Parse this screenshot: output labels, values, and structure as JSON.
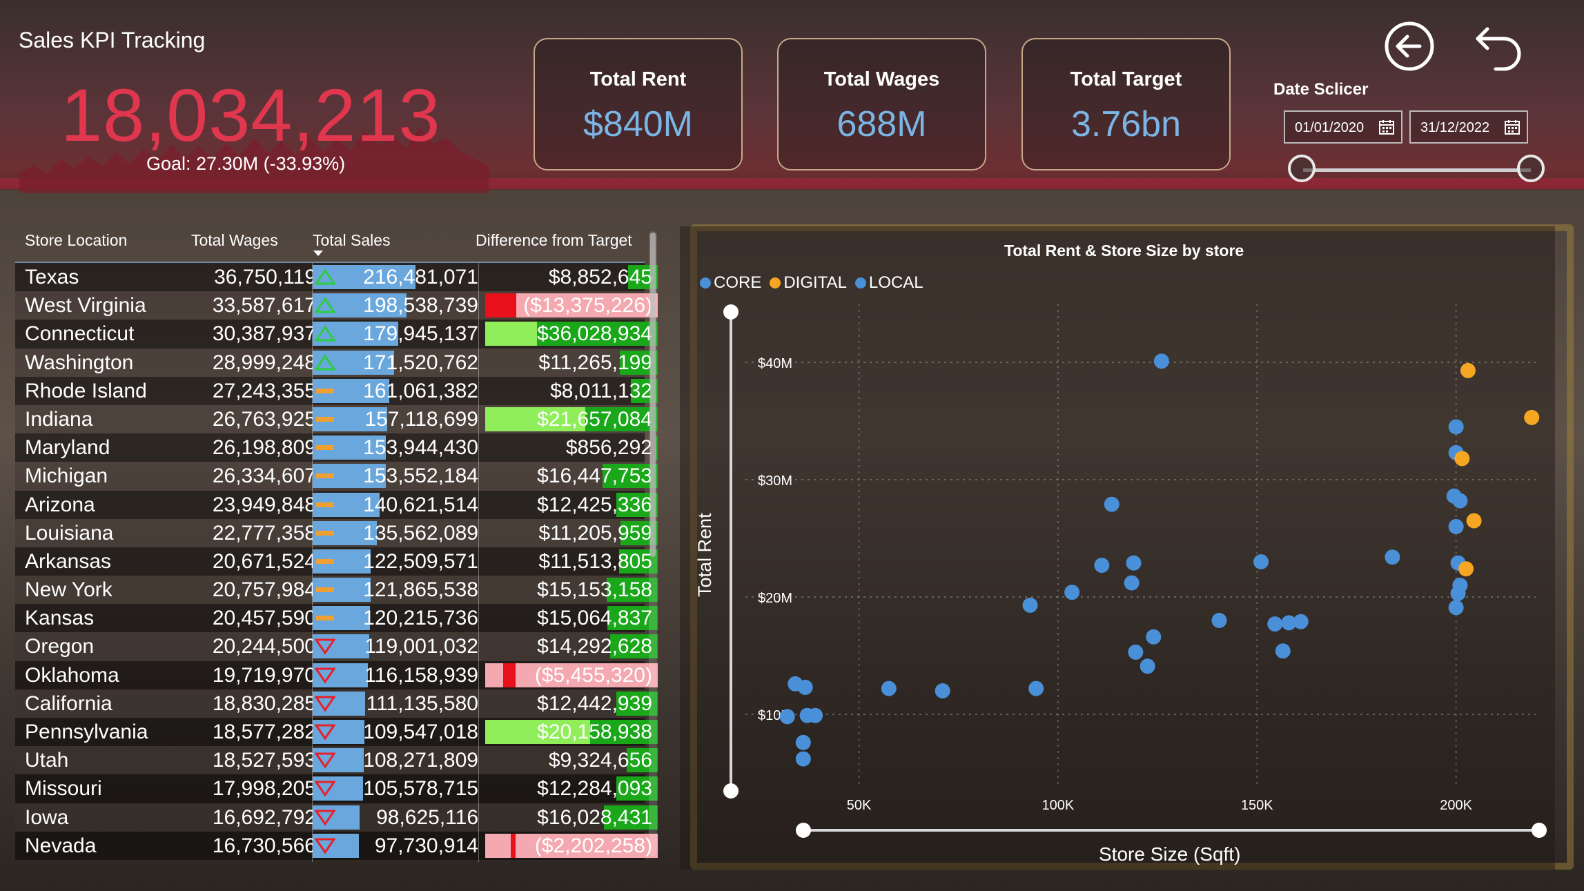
{
  "header": {
    "title": "Sales KPI Tracking",
    "kpi_value": "18,034,213",
    "goal_text": "Goal: 27.30M (-33.93%)"
  },
  "cards": [
    {
      "title": "Total Rent",
      "value": "$840M"
    },
    {
      "title": "Total Wages",
      "value": "688M"
    },
    {
      "title": "Total Target",
      "value": "3.76bn"
    }
  ],
  "nav": {
    "back_icon": "circle-arrow-left-icon",
    "undo_icon": "undo-arrow-icon"
  },
  "slicer": {
    "title": "Date Sclicer",
    "start_date": "01/01/2020",
    "end_date": "31/12/2022",
    "calendar_icon": "calendar-icon"
  },
  "table": {
    "columns": [
      "Store Location",
      "Total Wages",
      "Total Sales",
      "Difference from Target"
    ],
    "sorted_column": "Total Sales",
    "colors": {
      "up": "#2ecc40",
      "flat": "#f0a030",
      "down": "#e8202a",
      "sales_bar": "#6aa7dc",
      "pos_dark": "#1aa81a",
      "pos_light": "#90ee5a",
      "neg_red": "#e8101a",
      "neg_light": "#f4a8b0"
    },
    "rows": [
      {
        "location": "Texas",
        "wages": "36,750,119",
        "sales": "216,481,071",
        "sales_num": 216481071,
        "trend": "up",
        "diff": "$8,852,645",
        "diff_num": 8852645
      },
      {
        "location": "West Virginia",
        "wages": "33,587,617",
        "sales": "198,538,739",
        "sales_num": 198538739,
        "trend": "up",
        "diff": "($13,375,226)",
        "diff_num": -13375226
      },
      {
        "location": "Connecticut",
        "wages": "30,387,937",
        "sales": "179,945,137",
        "sales_num": 179945137,
        "trend": "up",
        "diff": "$36,028,934",
        "diff_num": 36028934
      },
      {
        "location": "Washington",
        "wages": "28,999,248",
        "sales": "171,520,762",
        "sales_num": 171520762,
        "trend": "up",
        "diff": "$11,265,199",
        "diff_num": 11265199
      },
      {
        "location": "Rhode Island",
        "wages": "27,243,355",
        "sales": "161,061,382",
        "sales_num": 161061382,
        "trend": "flat",
        "diff": "$8,011,132",
        "diff_num": 8011132
      },
      {
        "location": "Indiana",
        "wages": "26,763,925",
        "sales": "157,118,699",
        "sales_num": 157118699,
        "trend": "flat",
        "diff": "$21,657,084",
        "diff_num": 21657084
      },
      {
        "location": "Maryland",
        "wages": "26,198,809",
        "sales": "153,944,430",
        "sales_num": 153944430,
        "trend": "flat",
        "diff": "$856,292",
        "diff_num": 856292
      },
      {
        "location": "Michigan",
        "wages": "26,334,607",
        "sales": "153,552,184",
        "sales_num": 153552184,
        "trend": "flat",
        "diff": "$16,447,753",
        "diff_num": 16447753
      },
      {
        "location": "Arizona",
        "wages": "23,949,848",
        "sales": "140,621,514",
        "sales_num": 140621514,
        "trend": "flat",
        "diff": "$12,425,336",
        "diff_num": 12425336
      },
      {
        "location": "Louisiana",
        "wages": "22,777,358",
        "sales": "135,562,089",
        "sales_num": 135562089,
        "trend": "flat",
        "diff": "$11,205,959",
        "diff_num": 11205959
      },
      {
        "location": "Arkansas",
        "wages": "20,671,524",
        "sales": "122,509,571",
        "sales_num": 122509571,
        "trend": "flat",
        "diff": "$11,513,805",
        "diff_num": 11513805
      },
      {
        "location": "New York",
        "wages": "20,757,984",
        "sales": "121,865,538",
        "sales_num": 121865538,
        "trend": "flat",
        "diff": "$15,153,158",
        "diff_num": 15153158
      },
      {
        "location": "Kansas",
        "wages": "20,457,590",
        "sales": "120,215,736",
        "sales_num": 120215736,
        "trend": "flat",
        "diff": "$15,064,837",
        "diff_num": 15064837
      },
      {
        "location": "Oregon",
        "wages": "20,244,500",
        "sales": "119,001,032",
        "sales_num": 119001032,
        "trend": "down",
        "diff": "$14,292,628",
        "diff_num": 14292628
      },
      {
        "location": "Oklahoma",
        "wages": "19,719,970",
        "sales": "116,158,939",
        "sales_num": 116158939,
        "trend": "down",
        "diff": "($5,455,320)",
        "diff_num": -5455320
      },
      {
        "location": "California",
        "wages": "18,830,285",
        "sales": "111,135,580",
        "sales_num": 111135580,
        "trend": "down",
        "diff": "$12,442,939",
        "diff_num": 12442939
      },
      {
        "location": "Pennsylvania",
        "wages": "18,577,282",
        "sales": "109,547,018",
        "sales_num": 109547018,
        "trend": "down",
        "diff": "$20,158,938",
        "diff_num": 20158938
      },
      {
        "location": "Utah",
        "wages": "18,527,593",
        "sales": "108,271,809",
        "sales_num": 108271809,
        "trend": "down",
        "diff": "$9,324,656",
        "diff_num": 9324656
      },
      {
        "location": "Missouri",
        "wages": "17,998,205",
        "sales": "105,578,715",
        "sales_num": 105578715,
        "trend": "down",
        "diff": "$12,284,093",
        "diff_num": 12284093
      },
      {
        "location": "Iowa",
        "wages": "16,692,792",
        "sales": "98,625,116",
        "sales_num": 98625116,
        "trend": "down",
        "diff": "$16,028,431",
        "diff_num": 16028431
      },
      {
        "location": "Nevada",
        "wages": "16,730,566",
        "sales": "97,730,914",
        "sales_num": 97730914,
        "trend": "down",
        "diff": "($2,202,258)",
        "diff_num": -2202258
      }
    ]
  },
  "chart_data": {
    "type": "scatter",
    "title": "Total Rent & Store Size by store",
    "xlabel": "Store Size (Sqft)",
    "ylabel": "Total Rent",
    "xlim": [
      18000,
      220000
    ],
    "ylim": [
      4000000,
      45000000
    ],
    "x_ticks": [
      {
        "v": 50000,
        "label": "50K"
      },
      {
        "v": 100000,
        "label": "100K"
      },
      {
        "v": 150000,
        "label": "150K"
      },
      {
        "v": 200000,
        "label": "200K"
      }
    ],
    "y_ticks": [
      {
        "v": 10000000,
        "label": "$10M"
      },
      {
        "v": 20000000,
        "label": "$20M"
      },
      {
        "v": 30000000,
        "label": "$30M"
      },
      {
        "v": 40000000,
        "label": "$40M"
      }
    ],
    "legend": [
      {
        "name": "CORE",
        "color": "#4a90d9"
      },
      {
        "name": "DIGITAL",
        "color": "#f5a623"
      },
      {
        "name": "LOCAL",
        "color": "#4a90d9"
      }
    ],
    "series": [
      {
        "name": "CORE",
        "color": "#4a90d9",
        "points": [
          [
            126000,
            40100000
          ],
          [
            113500,
            27900000
          ],
          [
            111000,
            22700000
          ],
          [
            119000,
            22900000
          ],
          [
            118500,
            21200000
          ],
          [
            151000,
            23000000
          ],
          [
            184000,
            23400000
          ],
          [
            93000,
            19300000
          ],
          [
            103500,
            20400000
          ],
          [
            140500,
            18000000
          ],
          [
            154500,
            17700000
          ],
          [
            158000,
            17800000
          ],
          [
            161000,
            17900000
          ],
          [
            156500,
            15400000
          ],
          [
            124000,
            16600000
          ],
          [
            119500,
            15300000
          ],
          [
            122500,
            14100000
          ],
          [
            34000,
            12600000
          ],
          [
            36500,
            12300000
          ],
          [
            57500,
            12200000
          ],
          [
            71000,
            12000000
          ],
          [
            94500,
            12200000
          ],
          [
            32000,
            9800000
          ],
          [
            37000,
            9900000
          ],
          [
            39000,
            9900000
          ],
          [
            36000,
            7600000
          ],
          [
            36000,
            6200000
          ],
          [
            200000,
            34500000
          ],
          [
            200000,
            32300000
          ],
          [
            199500,
            28600000
          ],
          [
            201000,
            28200000
          ],
          [
            200000,
            26000000
          ],
          [
            200500,
            22900000
          ],
          [
            201000,
            21000000
          ],
          [
            200500,
            20300000
          ],
          [
            200000,
            19100000
          ]
        ]
      },
      {
        "name": "DIGITAL",
        "color": "#f5a623",
        "points": [
          [
            203000,
            39300000
          ],
          [
            219000,
            35300000
          ],
          [
            201500,
            31800000
          ],
          [
            204500,
            26500000
          ],
          [
            202500,
            22400000
          ]
        ]
      }
    ]
  }
}
